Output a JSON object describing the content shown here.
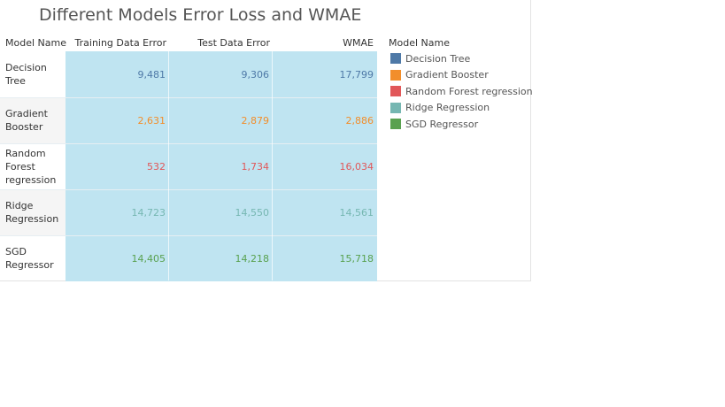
{
  "chart_data": {
    "type": "table",
    "title": "Different Models Error Loss and WMAE",
    "row_header": "Model Name",
    "columns": [
      "Training Data Error",
      "Test Data Error",
      "WMAE"
    ],
    "rows": [
      {
        "label": "Decision Tree",
        "label_lines": [
          "Decision",
          "Tree"
        ],
        "values": [
          "9,481",
          "9,306",
          "17,799"
        ],
        "color": "#4e79a7"
      },
      {
        "label": "Gradient Booster",
        "label_lines": [
          "Gradient",
          "Booster"
        ],
        "values": [
          "2,631",
          "2,879",
          "2,886"
        ],
        "color": "#f28e2b"
      },
      {
        "label": "Random Forest regression",
        "label_lines": [
          "Random",
          "Forest",
          "regression"
        ],
        "values": [
          "532",
          "1,734",
          "16,034"
        ],
        "color": "#e15759"
      },
      {
        "label": "Ridge Regression",
        "label_lines": [
          "Ridge",
          "Regression"
        ],
        "values": [
          "14,723",
          "14,550",
          "14,561"
        ],
        "color": "#76b7b2"
      },
      {
        "label": "SGD Regressor",
        "label_lines": [
          "SGD",
          "Regressor"
        ],
        "values": [
          "14,405",
          "14,218",
          "15,718"
        ],
        "color": "#59a14f"
      }
    ],
    "legend": {
      "title": "Model Name",
      "position": "right",
      "items": [
        {
          "label": "Decision Tree",
          "color": "#4e79a7"
        },
        {
          "label": "Gradient Booster",
          "color": "#f28e2b"
        },
        {
          "label": "Random Forest regression",
          "color": "#e15759"
        },
        {
          "label": "Ridge Regression",
          "color": "#76b7b2"
        },
        {
          "label": "SGD Regressor",
          "color": "#59a14f"
        }
      ]
    },
    "cell_background": "#bfe4f1"
  }
}
